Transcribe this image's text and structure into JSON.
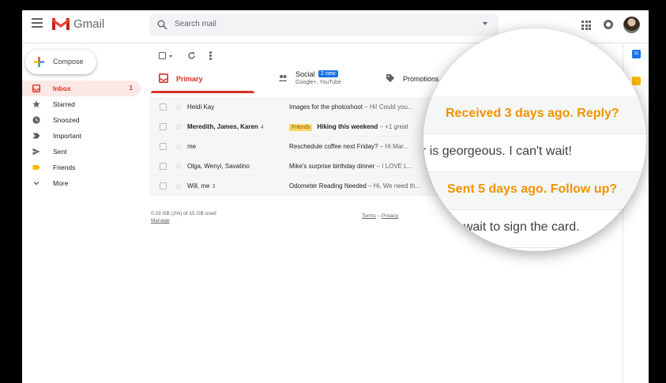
{
  "header": {
    "brand": "Gmail",
    "search_placeholder": "Search mail"
  },
  "sidebar": {
    "compose_label": "Compose",
    "items": [
      {
        "label": "Inbox",
        "count": "1",
        "icon": "inbox-icon"
      },
      {
        "label": "Starred",
        "icon": "star-icon"
      },
      {
        "label": "Snoozed",
        "icon": "clock-icon"
      },
      {
        "label": "Important",
        "icon": "important-icon"
      },
      {
        "label": "Sent",
        "icon": "send-icon"
      },
      {
        "label": "Friends",
        "icon": "label-icon"
      },
      {
        "label": "More",
        "icon": "chevron-down-icon"
      }
    ]
  },
  "tabs": {
    "primary": "Primary",
    "social": "Social",
    "social_badge": "2 new",
    "social_sub": "Google+, YouTube",
    "promotions": "Promotions"
  },
  "emails": [
    {
      "sender": "Heidi Kay",
      "sender_count": "",
      "label": "",
      "subject": "Images for the photoshoot",
      "snippet": " – Hi! Could you..."
    },
    {
      "sender": "Meredith, James, Karen",
      "sender_count": "4",
      "label": "Friends",
      "subject": "Hiking this weekend",
      "snippet": " – +1 great"
    },
    {
      "sender": "me",
      "sender_count": "",
      "label": "",
      "subject": "Reschedule coffee next Friday?",
      "snippet": " – Hi Mar..."
    },
    {
      "sender": "Olga, Wenyi, Savatino",
      "sender_count": "",
      "label": "",
      "subject": "Mike's surprise birthday dinner",
      "snippet": " – I LOVE L..."
    },
    {
      "sender": "Will, me",
      "sender_count": "3",
      "label": "",
      "subject": "Odometer Reading Needed",
      "snippet": " – Hi, We need th..."
    }
  ],
  "footer": {
    "storage": "0.33 GB (2%) of 15 GB used",
    "manage": "Manage",
    "terms": "Terms",
    "separator": " – ",
    "privacy": "Privacy"
  },
  "magnifier": {
    "lines": [
      {
        "text": "Received 3 days ago. Reply?",
        "kind": "nudge"
      },
      {
        "text": "r is georgeous.  I can't wait!",
        "kind": "plain"
      },
      {
        "text": "Sent 5 days ago. Follow up?",
        "kind": "nudge"
      },
      {
        "text": "n't wait to sign the card.",
        "kind": "plain"
      }
    ]
  },
  "colors": {
    "accent_red": "#d93025",
    "nudge_orange": "#f09300",
    "badge_blue": "#1a73e8"
  }
}
